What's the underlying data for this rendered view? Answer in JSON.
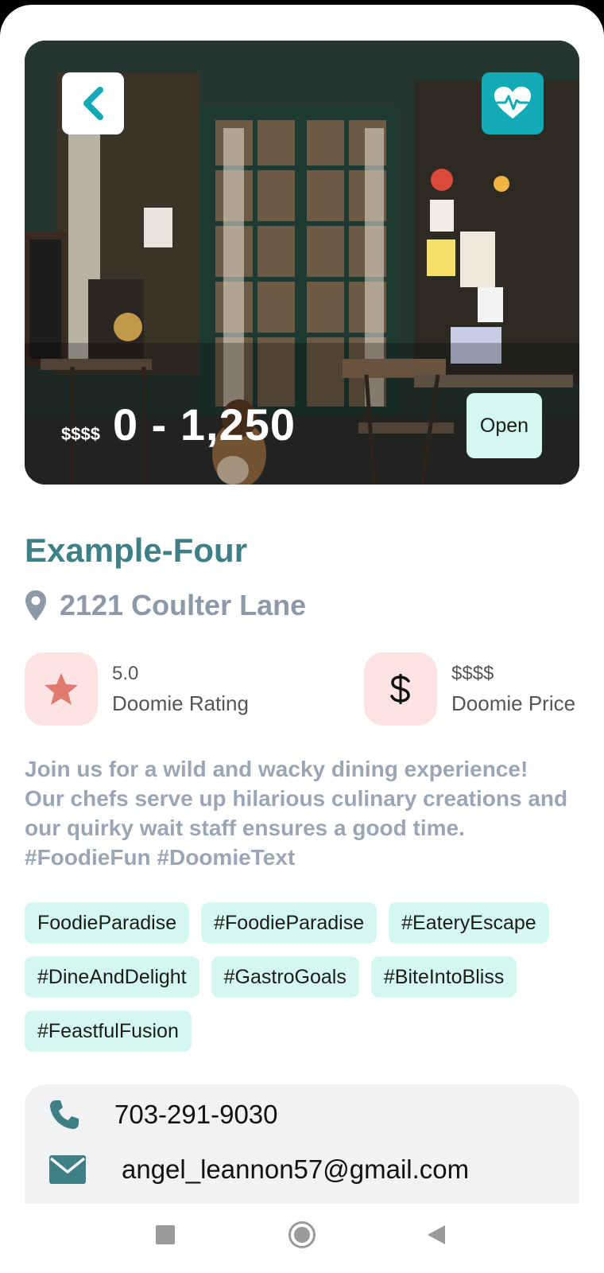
{
  "hero": {
    "price_symbol": "$$$$",
    "price_range": "0 - 1,250",
    "status": "Open"
  },
  "restaurant": {
    "name": "Example-Four",
    "address": "2121 Coulter Lane"
  },
  "metrics": {
    "rating_value": "5.0",
    "rating_label": "Doomie Rating",
    "price_value": "$$$$",
    "price_label": "Doomie Price"
  },
  "description": "Join us for a wild and wacky dining experience! Our chefs serve up hilarious culinary creations and our quirky wait staff ensures a good time. #FoodieFun #DoomieText",
  "tags": [
    "FoodieParadise",
    "#FoodieParadise",
    "#EateryEscape",
    "#DineAndDelight",
    "#GastroGoals",
    "#BiteIntoBliss",
    "#FeastfulFusion"
  ],
  "contact": {
    "phone": "703-291-9030",
    "email": "angel_leannon57@gmail.com"
  },
  "colors": {
    "accent": "#3f7f86",
    "teal_button": "#11aab5",
    "tag_bg": "#d4f8ef",
    "metric_bg": "#fde3e3",
    "star": "#e07a6e"
  },
  "icons": {
    "back": "chevron-left-icon",
    "favorite": "heart-pulse-icon",
    "location": "map-pin-icon",
    "rating": "star-icon",
    "price": "dollar-icon",
    "phone": "phone-icon",
    "email": "envelope-icon"
  }
}
